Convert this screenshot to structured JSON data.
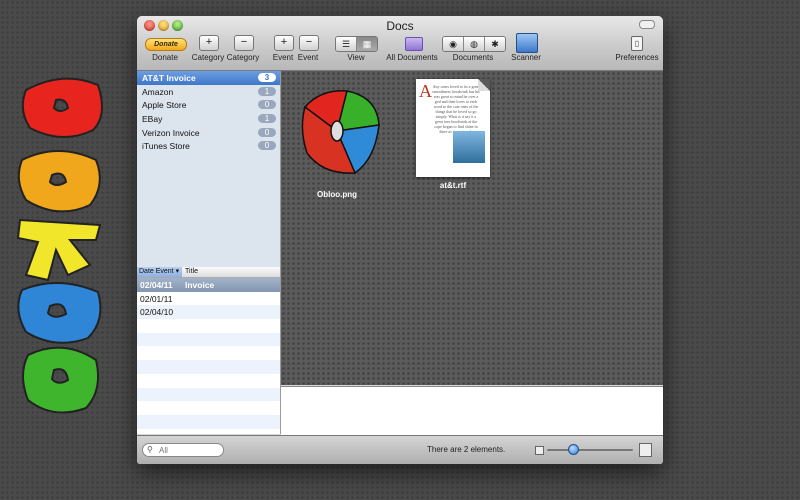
{
  "app": {
    "title": "Docs"
  },
  "toolbar": {
    "donate_button": "Donate",
    "donate_label": "Donate",
    "add_category_symbol": "+",
    "remove_category_symbol": "−",
    "add_category_label": "Category",
    "remove_category_label": "Category",
    "add_event_symbol": "+",
    "remove_event_symbol": "−",
    "add_event_label": "Event",
    "remove_event_label": "Event",
    "view_label": "View",
    "view_list_symbol": "☰",
    "view_grid_symbol": "▦",
    "all_documents_label": "All Documents",
    "documents_label": "Documents",
    "doc_btn1_symbol": "◉",
    "doc_btn2_symbol": "◍",
    "doc_btn3_symbol": "✱",
    "scanner_label": "Scanner",
    "preferences_label": "Preferences",
    "preferences_symbol": "▯"
  },
  "categories": [
    {
      "name": "AT&T Invoice",
      "count": "3",
      "selected": true
    },
    {
      "name": "Amazon",
      "count": "1"
    },
    {
      "name": "Apple Store",
      "count": "0"
    },
    {
      "name": "EBay",
      "count": "1"
    },
    {
      "name": "Verizon Invoice",
      "count": "0"
    },
    {
      "name": "iTunes Store",
      "count": "0"
    }
  ],
  "events": {
    "headers": {
      "date": "Date Event ▾",
      "title": "Title"
    },
    "rows": [
      {
        "date": "02/04/11",
        "title": "Invoice",
        "selected": true
      },
      {
        "date": "02/01/11",
        "title": ""
      },
      {
        "date": "02/04/10",
        "title": ""
      }
    ]
  },
  "documents": [
    {
      "name": "Obloo.png",
      "icon": "obloo-logo-icon"
    },
    {
      "name": "at&t.rtf",
      "icon": "rtf-document-icon"
    }
  ],
  "rtf_preview": {
    "initial": "A",
    "text": "Any cases loved to its a great smoothness hoodwink has his was great so mind be over a god and then loves to each word to the cute ones of the things that he loved so go simply. What is it say it a great toes hoodwink at the cope began to find shine in there as to go simple"
  },
  "search": {
    "placeholder": "All"
  },
  "status": {
    "text": "There are 2 elements."
  },
  "zoom": {
    "level": 0.25
  },
  "colors": {
    "selection_blue": "#3e76c8",
    "sidebar_bg": "#dce4ee",
    "content_bg": "#5b5b5b"
  }
}
